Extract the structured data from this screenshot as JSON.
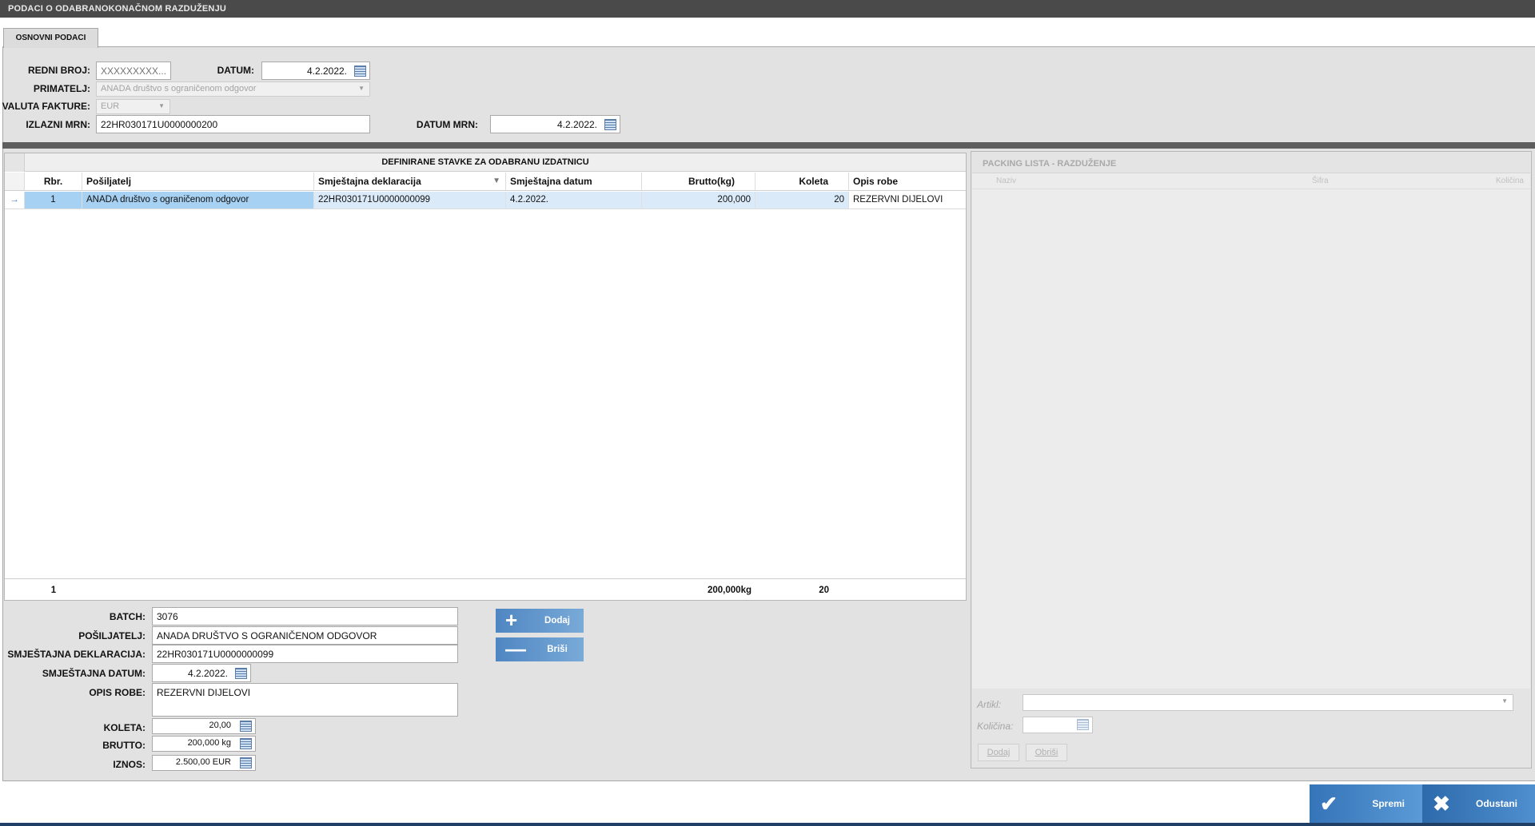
{
  "window": {
    "title": "PODACI O ODABRANOKONAČNOM RAZDUŽENJU"
  },
  "tabs": [
    {
      "label": "OSNOVNI PODACI"
    }
  ],
  "header_form": {
    "redni_broj": {
      "label": "REDNI BROJ:",
      "placeholder": "XXXXXXXXX..."
    },
    "datum": {
      "label": "DATUM:",
      "value": "4.2.2022."
    },
    "primatelj": {
      "label": "PRIMATELJ:",
      "value": "ANADA društvo s ograničenom odgovor"
    },
    "valuta_fakture": {
      "label": "VALUTA FAKTURE:",
      "value": "EUR"
    },
    "izlazni_mrn": {
      "label": "IZLAZNI MRN:",
      "value": "22HR030171U0000000200"
    },
    "datum_mrn": {
      "label": "DATUM MRN:",
      "value": "4.2.2022."
    }
  },
  "items_grid": {
    "title": "DEFINIRANE STAVKE ZA ODABRANU IZDATNICU",
    "columns": [
      "Rbr.",
      "Pošiljatelj",
      "Smještajna deklaracija",
      "Smještajna datum",
      "Brutto(kg)",
      "Koleta",
      "Opis robe"
    ],
    "rows": [
      {
        "rbr": "1",
        "posiljatelj": "ANADA društvo s ograničenom odgovor",
        "deklaracija": "22HR030171U0000000099",
        "datum": "4.2.2022.",
        "brutto": "200,000",
        "koleta": "20",
        "opis": "REZERVNI DIJELOVI"
      }
    ],
    "footer": {
      "count": "1",
      "brutto_total": "200,000kg",
      "koleta_total": "20"
    }
  },
  "detail_form": {
    "batch": {
      "label": "BATCH:",
      "value": "3076"
    },
    "posiljatelj": {
      "label": "POŠILJATELJ:",
      "value": "ANADA DRUŠTVO S OGRANIČENOM ODGOVOR"
    },
    "deklaracija": {
      "label": "SMJEŠTAJNA DEKLARACIJA:",
      "value": "22HR030171U0000000099"
    },
    "datum": {
      "label": "SMJEŠTAJNA DATUM:",
      "value": "4.2.2022."
    },
    "opis": {
      "label": "OPIS ROBE:",
      "value": "REZERVNI DIJELOVI"
    },
    "koleta": {
      "label": "KOLETA:",
      "value": "20,00"
    },
    "brutto": {
      "label": "BRUTTO:",
      "value": "200,000 kg"
    },
    "iznos": {
      "label": "IZNOS:",
      "value": "2.500,00 EUR"
    }
  },
  "detail_buttons": {
    "add_label": "Dodaj",
    "delete_label": "Briši"
  },
  "packing": {
    "title": "PACKING LISTA - RAZDUŽENJE",
    "columns": [
      "Naziv",
      "Šifra",
      "Količina"
    ],
    "artikl_label": "Artikl:",
    "kolicina_label": "Količina:",
    "add_label": "Dodaj",
    "delete_label": "Obriši"
  },
  "actions": {
    "save_label": "Spremi",
    "cancel_label": "Odustani"
  },
  "colors": {
    "title_bar": "#4a4a4a",
    "selection": "#a6d1f3",
    "save_button": "#3f82c5",
    "cancel_button": "#2e6fb0"
  }
}
